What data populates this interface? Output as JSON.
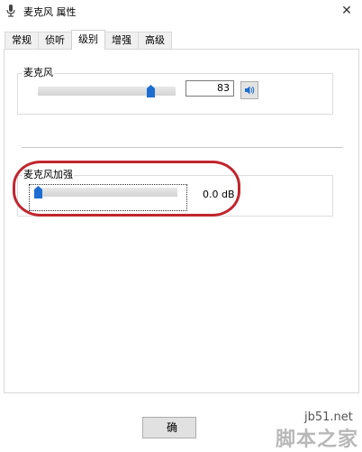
{
  "window": {
    "title": "麦克风 属性",
    "close_glyph": "✕"
  },
  "tabs": [
    {
      "label": "常规",
      "active": false
    },
    {
      "label": "侦听",
      "active": false
    },
    {
      "label": "级别",
      "active": true
    },
    {
      "label": "增强",
      "active": false
    },
    {
      "label": "高级",
      "active": false
    }
  ],
  "microphone": {
    "label": "麦克风",
    "value": "83",
    "level_fraction": 0.83,
    "icon": "speaker-icon"
  },
  "boost": {
    "label": "麦克风加强",
    "value": "0.0 dB",
    "level_fraction": 0.0
  },
  "buttons": {
    "ok_label": "确"
  },
  "watermark": {
    "url": "jb51.net",
    "text": "脚本之家"
  },
  "colors": {
    "thumb": "#1e6ed1",
    "annotation": "#c0262e",
    "accent_speaker": "#1e6ed1"
  }
}
